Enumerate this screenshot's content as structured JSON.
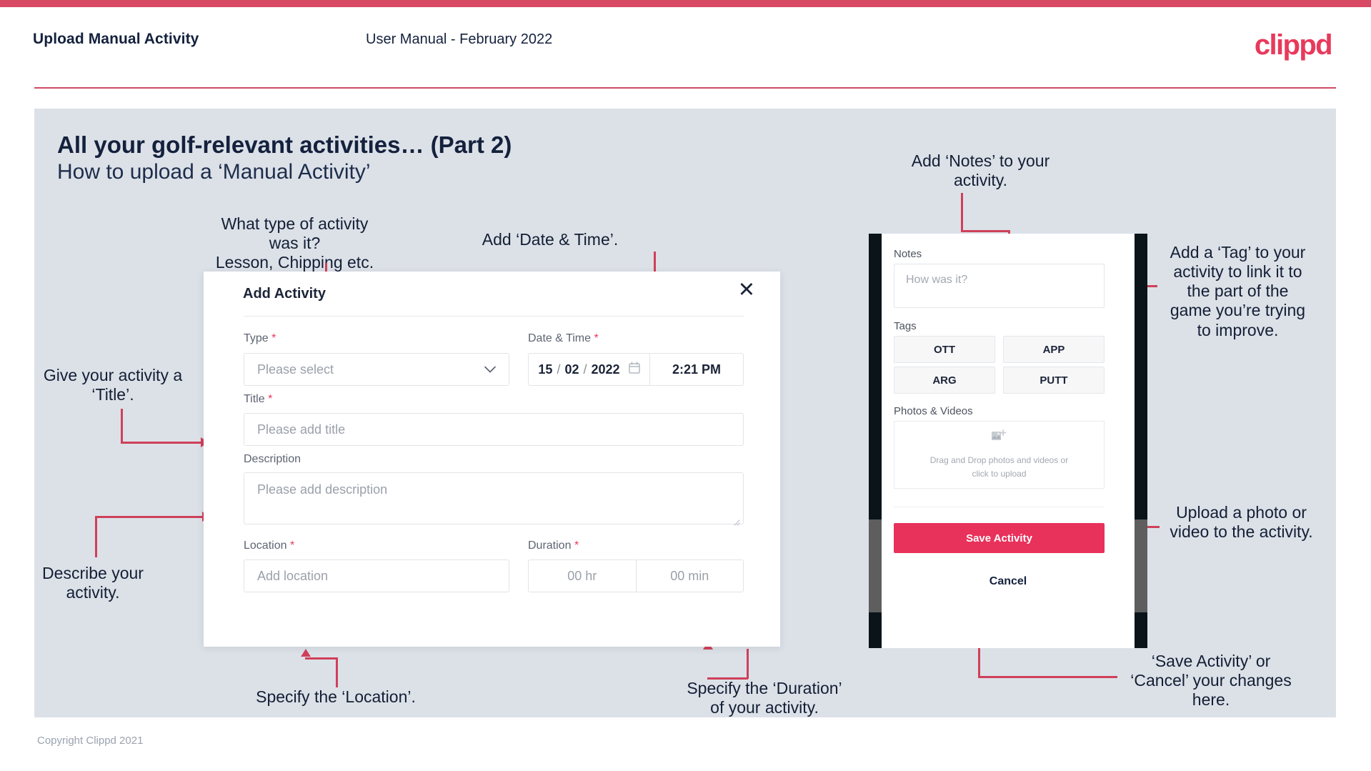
{
  "header": {
    "title": "Upload Manual Activity",
    "subtitle": "User Manual - February 2022",
    "brand": "clippd"
  },
  "slide": {
    "title": "All your golf-relevant activities… (Part 2)",
    "subtitle": "How to upload a ‘Manual Activity’"
  },
  "footer": {
    "copyright": "Copyright Clippd 2021"
  },
  "colors": {
    "brand_crimson": "#e8395c",
    "line_crimson": "#cf4059",
    "save_button": "#e8315b",
    "slide_bg": "#dce1e8",
    "text_navy": "#14213d"
  },
  "dialog": {
    "title": "Add Activity",
    "close_icon": "close-icon",
    "fields": {
      "type": {
        "label": "Type",
        "required": true,
        "placeholder": "Please select"
      },
      "datetime": {
        "label": "Date & Time",
        "required": true,
        "day": "15",
        "month": "02",
        "year": "2022",
        "separator": "/",
        "time": "2:21 PM",
        "calendar_icon": "calendar-icon"
      },
      "title": {
        "label": "Title",
        "required": true,
        "placeholder": "Please add title"
      },
      "description": {
        "label": "Description",
        "required": false,
        "placeholder": "Please add description"
      },
      "location": {
        "label": "Location",
        "required": true,
        "placeholder": "Add location"
      },
      "duration": {
        "label": "Duration",
        "required": true,
        "hours": "00 hr",
        "minutes": "00 min"
      }
    },
    "required_marker": "*"
  },
  "phone": {
    "notes": {
      "label": "Notes",
      "placeholder": "How was it?"
    },
    "tags": {
      "label": "Tags",
      "items": [
        "OTT",
        "APP",
        "ARG",
        "PUTT"
      ]
    },
    "photos": {
      "label": "Photos & Videos",
      "icon": "add-image-icon",
      "line1": "Drag and Drop photos and videos or",
      "line2": "click to upload"
    },
    "save_label": "Save Activity",
    "cancel_label": "Cancel"
  },
  "annotations": {
    "type": "What type of activity was it?\nLesson, Chipping etc.",
    "datetime": "Add ‘Date & Time’.",
    "title": "Give your activity a\n‘Title’.",
    "description": "Describe your\nactivity.",
    "location": "Specify the ‘Location’.",
    "duration": "Specify the ‘Duration’\nof your activity.",
    "notes": "Add ‘Notes’ to your\nactivity.",
    "tags": "Add a ‘Tag’ to your\nactivity to link it to\nthe part of the\ngame you’re trying\nto improve.",
    "photos": "Upload a photo or\nvideo to the activity.",
    "save": "‘Save Activity’ or\n‘Cancel’ your changes\nhere."
  }
}
